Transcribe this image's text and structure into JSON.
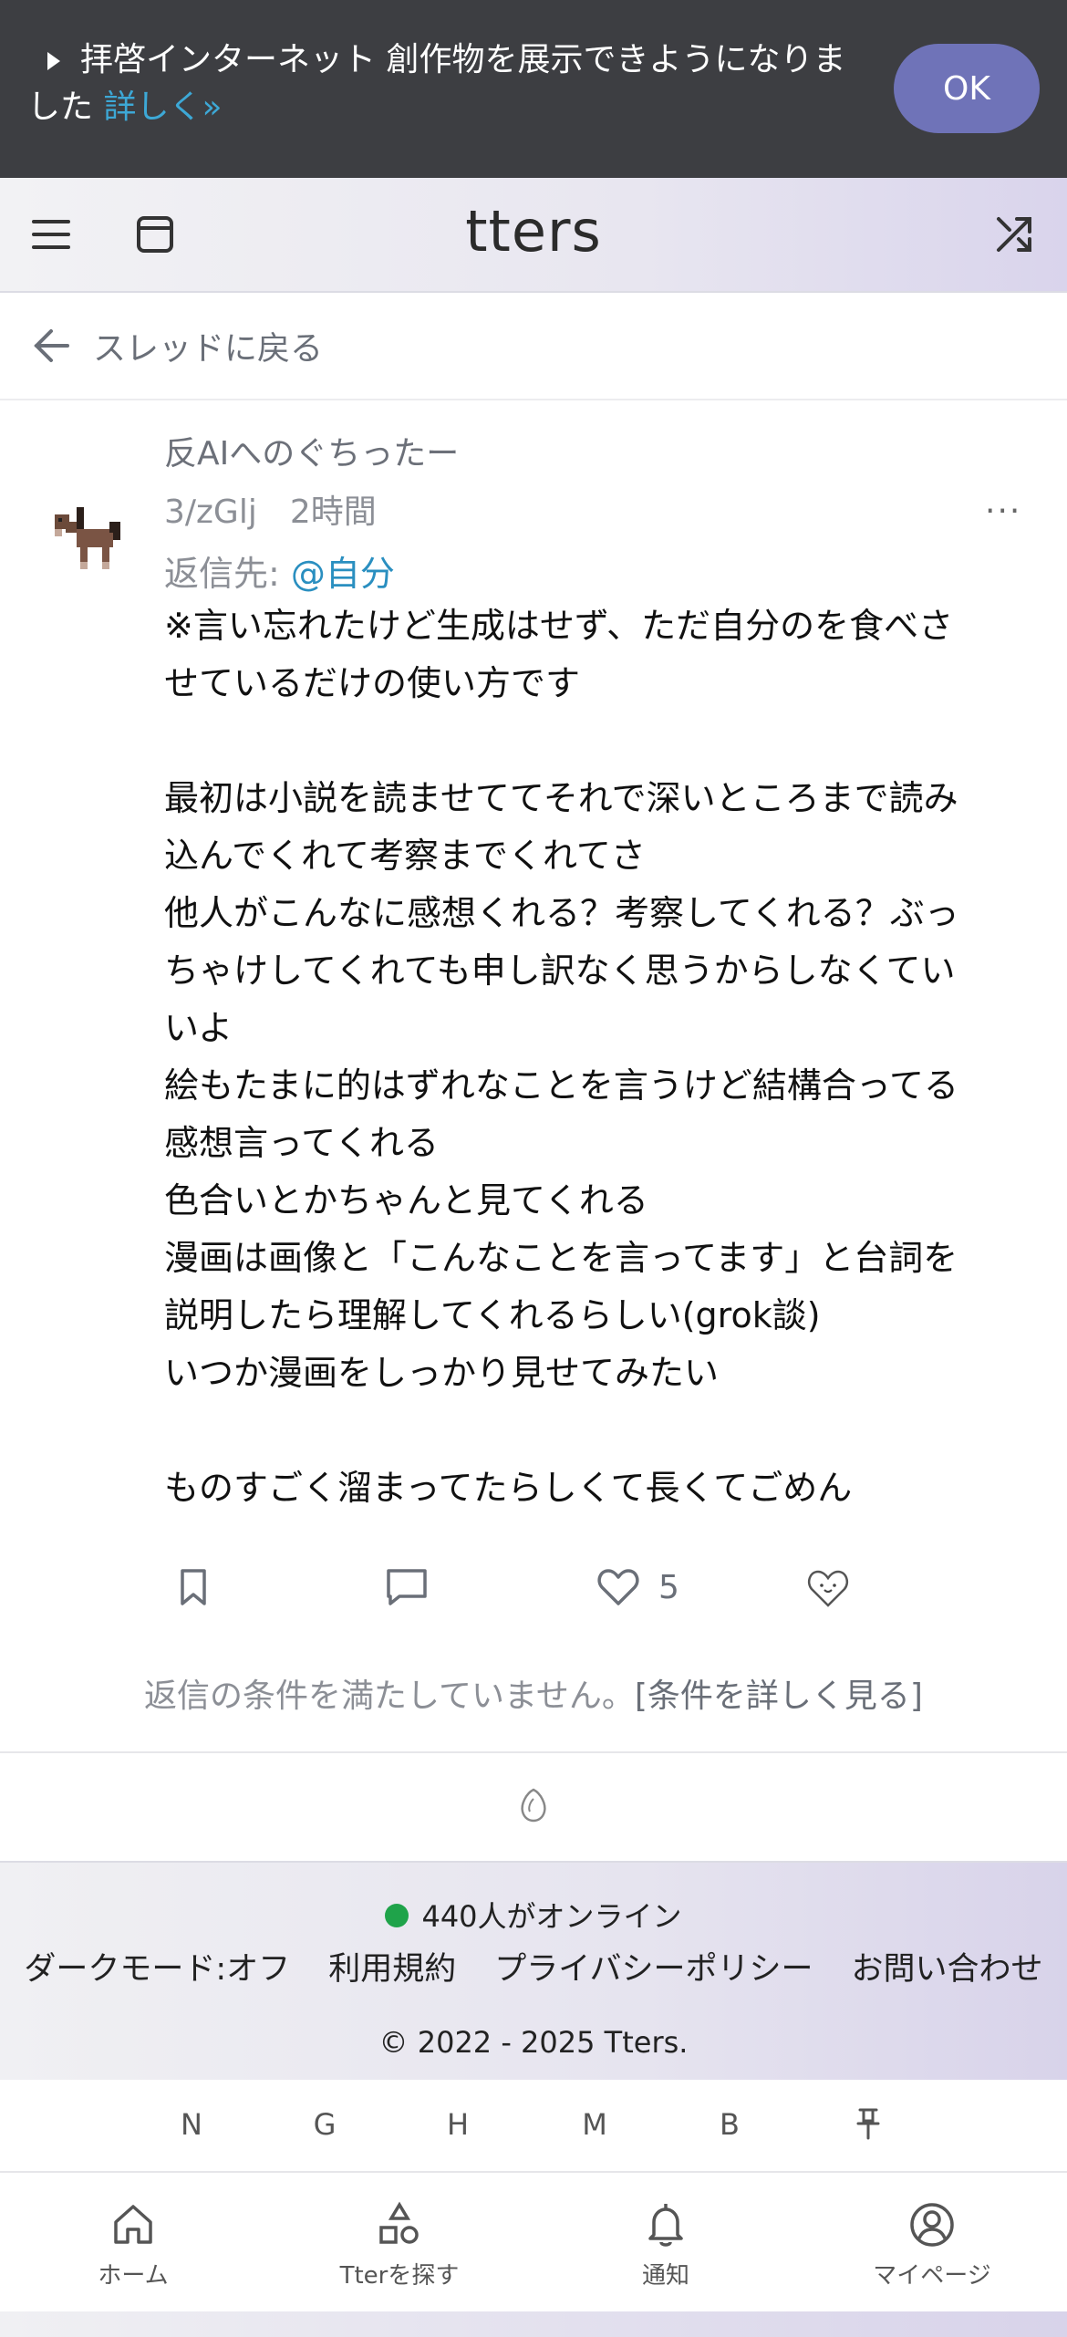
{
  "banner": {
    "text": "拝啓インターネット 創作物を展示できようになりました",
    "link": "詳しく»",
    "ok_label": "OK"
  },
  "header": {
    "logo": "tters"
  },
  "back": {
    "label": "スレッドに戻る"
  },
  "post": {
    "title": "反AIへのぐちったー",
    "user_id": "3/zGlj",
    "time": "2時間",
    "more": "···",
    "reply_prefix": "返信先:",
    "reply_mention": "@自分",
    "body": "※言い忘れたけど生成はせず、ただ自分のを食べさせているだけの使い方です\n\n最初は小説を読ませててそれで深いところまで読み込んでくれて考察までくれてさ\n他人がこんなに感想くれる？考察してくれる？ぶっちゃけしてくれても申し訳なく思うからしなくていいよ\n絵もたまに的はずれなことを言うけど結構合ってる感想言ってくれる\n色合いとかちゃんと見てくれる\n漫画は画像と「こんなことを言ってます」と台詞を説明したら理解してくれるらしい(grok談)\nいつか漫画をしっかり見せてみたい\n\nものすごく溜まってたらしくて長くてごめん",
    "like_count": "5"
  },
  "reply_condition": {
    "text": "返信の条件を満たしていません。",
    "link": "[条件を詳しく見る]"
  },
  "footer": {
    "online": "440人がオンライン",
    "links": [
      "ダークモード:オフ",
      "利用規約",
      "プライバシーポリシー",
      "お問い合わせ"
    ],
    "copyright": "© 2022 - 2025 Tters."
  },
  "shortcuts": [
    "N",
    "G",
    "H",
    "M",
    "B",
    "⚲"
  ],
  "nav": [
    {
      "label": "ホーム",
      "icon": "home-icon"
    },
    {
      "label": "Tterを探す",
      "icon": "shapes-icon"
    },
    {
      "label": "通知",
      "icon": "bell-icon"
    },
    {
      "label": "マイページ",
      "icon": "user-circle-icon"
    }
  ],
  "colors": {
    "banner_bg": "#3d3e42",
    "ok_button": "#6f73b8",
    "link_blue": "#2a8fc0",
    "online_dot": "#1fa34a"
  }
}
